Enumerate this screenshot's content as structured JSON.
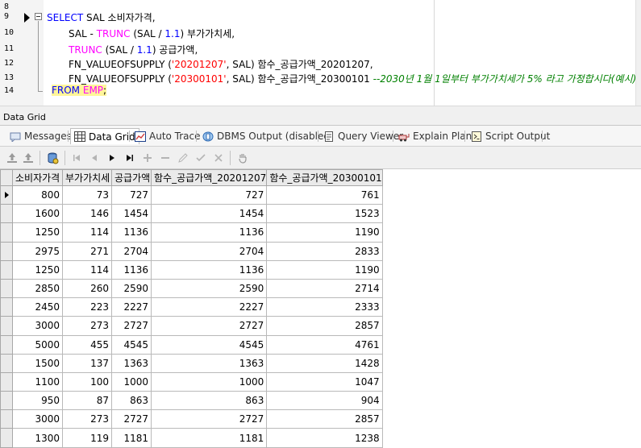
{
  "editor": {
    "lines": [
      {
        "num": "8"
      },
      {
        "num": "9"
      },
      {
        "num": "10"
      },
      {
        "num": "11"
      },
      {
        "num": "12"
      },
      {
        "num": "13"
      },
      {
        "num": "14"
      }
    ],
    "tokens": {
      "l9_select": "SELECT",
      "l9_rest": " SAL 소비자가격,",
      "l10_a": "SAL - ",
      "l10_trunc": "TRUNC",
      "l10_b": " (SAL / ",
      "l10_num": "1.1",
      "l10_c": ") 부가가치세,",
      "l11_trunc": "TRUNC",
      "l11_b": " (SAL / ",
      "l11_num": "1.1",
      "l11_c": ") 공급가액,",
      "l12_a": "FN_VALUEOFSUPPLY (",
      "l12_str": "'20201207'",
      "l12_b": ", SAL) 함수_공급가액_20201207,",
      "l13_a": "FN_VALUEOFSUPPLY (",
      "l13_str": "'20300101'",
      "l13_b": ", SAL) 함수_공급가액_20300101 ",
      "l13_cmt": "--2030년 1월 1일부터 부가가치세가 5% 라고 가정합시다(예시)",
      "l14_from": "FROM",
      "l14_sp": " ",
      "l14_emp": "EMP",
      "l14_semi": ";"
    }
  },
  "panel": {
    "title": "Data Grid"
  },
  "tabs": [
    {
      "label": "Messages",
      "icon": "messages-icon"
    },
    {
      "label": "Data Grid",
      "icon": "grid-icon",
      "active": true
    },
    {
      "label": "Auto Trace",
      "icon": "chart-icon"
    },
    {
      "label": "DBMS Output (disabled)",
      "icon": "dbms-output-icon"
    },
    {
      "label": "Query Viewer",
      "icon": "query-viewer-icon"
    },
    {
      "label": "Explain Plan",
      "icon": "explain-plan-icon"
    },
    {
      "label": "Script Output",
      "icon": "script-output-icon"
    }
  ],
  "navbar": {
    "icons": [
      "export-icon",
      "import-icon",
      "connection-icon",
      "first-record-icon",
      "prior-record-icon",
      "next-record-icon",
      "last-record-icon",
      "insert-record-icon",
      "delete-record-icon",
      "edit-record-icon",
      "post-edit-icon",
      "cancel-edit-icon",
      "hand-icon"
    ]
  },
  "grid": {
    "columns": [
      "소비자가격",
      "부가가치세",
      "공급가액",
      "함수_공급가액_20201207",
      "함수_공급가액_20300101"
    ],
    "rows": [
      [
        "800",
        "73",
        "727",
        "727",
        "761"
      ],
      [
        "1600",
        "146",
        "1454",
        "1454",
        "1523"
      ],
      [
        "1250",
        "114",
        "1136",
        "1136",
        "1190"
      ],
      [
        "2975",
        "271",
        "2704",
        "2704",
        "2833"
      ],
      [
        "1250",
        "114",
        "1136",
        "1136",
        "1190"
      ],
      [
        "2850",
        "260",
        "2590",
        "2590",
        "2714"
      ],
      [
        "2450",
        "223",
        "2227",
        "2227",
        "2333"
      ],
      [
        "3000",
        "273",
        "2727",
        "2727",
        "2857"
      ],
      [
        "5000",
        "455",
        "4545",
        "4545",
        "4761"
      ],
      [
        "1500",
        "137",
        "1363",
        "1363",
        "1428"
      ],
      [
        "1100",
        "100",
        "1000",
        "1000",
        "1047"
      ],
      [
        "950",
        "87",
        "863",
        "863",
        "904"
      ],
      [
        "3000",
        "273",
        "2727",
        "2727",
        "2857"
      ],
      [
        "1300",
        "119",
        "1181",
        "1181",
        "1238"
      ]
    ],
    "current_row": 0
  },
  "colors": {
    "keyword": "#0000ff",
    "function": "#ff00ff",
    "string": "#ff0000",
    "comment": "#008000",
    "highlight": "#fff59a"
  }
}
